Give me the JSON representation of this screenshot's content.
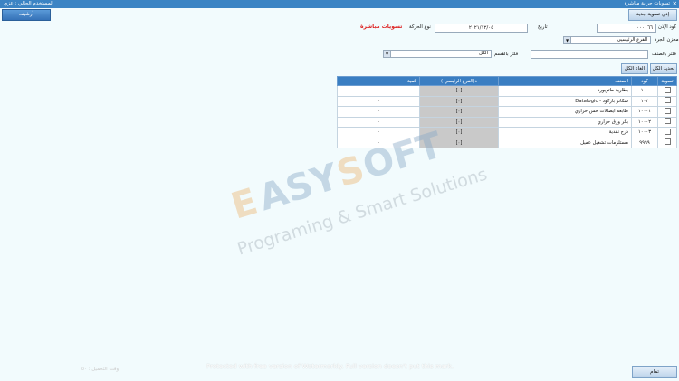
{
  "window": {
    "title": "تسويات جرابة مباشرة",
    "user": "المستخدم الحالي : عزي",
    "close": "✕"
  },
  "toolbar": {
    "new_label": "إدي تسوية جديد",
    "archive_label": "أرشيف"
  },
  "form": {
    "code_label": "كود الإذن",
    "code_value": "٠٠٠٠٦٦",
    "date_label": "تاريخ",
    "date_value": "٢٠٢١/١٢/٠٥",
    "movement_label": "نوع الحركة",
    "movement_value": "تسويات مباشرة",
    "store_label": "مخزن الجرد",
    "store_value": "الفرع الرئيسيى",
    "filter_item_label": "فلتر بالصنف",
    "filter_item_value": "",
    "filter_section_label": "فلتر بالقسم",
    "filter_section_value": "الكل"
  },
  "actions": {
    "select_all": "تحديد الكل",
    "deselect_all": "الغاء الكل"
  },
  "grid": {
    "headers": {
      "settle": "تسوية",
      "code": "كود",
      "item": "الصنف",
      "branch": "د(الفرع الرئيسي )",
      "qty": "كمية"
    },
    "rows": [
      {
        "code": "١٠٠",
        "item": "بطارية ماتريورد",
        "branch": "[٠]",
        "qty": "-"
      },
      {
        "code": "١٠٢",
        "item": "سكانر باركود - Datalogic",
        "branch": "[٠]",
        "qty": "-"
      },
      {
        "code": "١٠٠٠١",
        "item": "طابعة ايصالات حس حراري",
        "branch": "[٠]",
        "qty": "-"
      },
      {
        "code": "١٠٠٠٢",
        "item": "بكر ورق حراري",
        "branch": "[٠]",
        "qty": "-"
      },
      {
        "code": "١٠٠٠٣",
        "item": "درج نقدية",
        "branch": "[٠]",
        "qty": "-"
      },
      {
        "code": "٩٩٩٩",
        "item": "مستلزمات تشغيل عميل",
        "branch": "[٠]",
        "qty": "-"
      }
    ]
  },
  "bottom": {
    "done_label": "تمام",
    "load_time": "وقت التحميل : ٥٠",
    "notice": "Protected with free version of Watermarkly. Full version doesn't put this mark."
  },
  "watermark": {
    "brand": "EASY SOFT",
    "tagline": "Programing & Smart Solutions"
  }
}
